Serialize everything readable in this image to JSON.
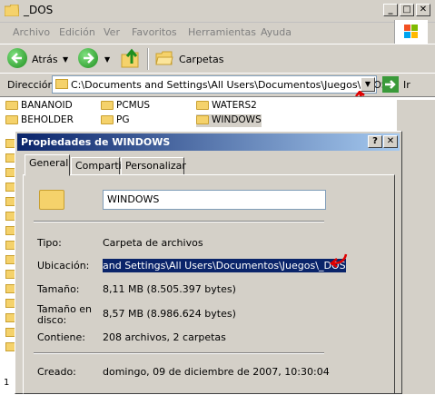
{
  "window": {
    "title": "_DOS",
    "buttons": {
      "minimize": "_",
      "maximize": "□",
      "close": "✕"
    }
  },
  "menubar": {
    "items": [
      "Archivo",
      "Edición",
      "Ver",
      "Favoritos",
      "Herramientas",
      "Ayuda"
    ]
  },
  "toolbar": {
    "back_label": "Atrás",
    "folders_label": "Carpetas"
  },
  "address": {
    "label": "Dirección",
    "value": "C:\\Documents and Settings\\All Users\\Documentos\\Juegos\\_DOS",
    "go_label": "Ir"
  },
  "files": [
    {
      "name": "BANANOID"
    },
    {
      "name": "PCMUS"
    },
    {
      "name": "WATERS2"
    },
    {
      "name": "BEHOLDER"
    },
    {
      "name": "PG"
    },
    {
      "name": "WINDOWS"
    }
  ],
  "status": {
    "text": "1"
  },
  "dialog": {
    "title": "Propiedades de WINDOWS",
    "help_button": "?",
    "close_button": "✕",
    "tabs": [
      "General",
      "Compartir",
      "Personalizar"
    ],
    "name": "WINDOWS",
    "fields": [
      {
        "label": "Tipo:",
        "value": "Carpeta de archivos"
      },
      {
        "label": "Ubicación:",
        "value": "and Settings\\All Users\\Documentos\\Juegos\\_DOS"
      },
      {
        "label": "Tamaño:",
        "value": "8,11 MB (8.505.397 bytes)"
      },
      {
        "label": "Tamaño en disco:",
        "value": "8,57 MB (8.986.624 bytes)"
      },
      {
        "label": "Contiene:",
        "value": "208 archivos, 2 carpetas"
      },
      {
        "label": "Creado:",
        "value": "domingo, 09 de diciembre de 2007, 10:30:04"
      }
    ]
  },
  "colors": {
    "dialog_title_start": "#0a246a",
    "dialog_title_end": "#a6caf0",
    "selection": "#0a246a",
    "annotation_arrow": "#e00000"
  }
}
